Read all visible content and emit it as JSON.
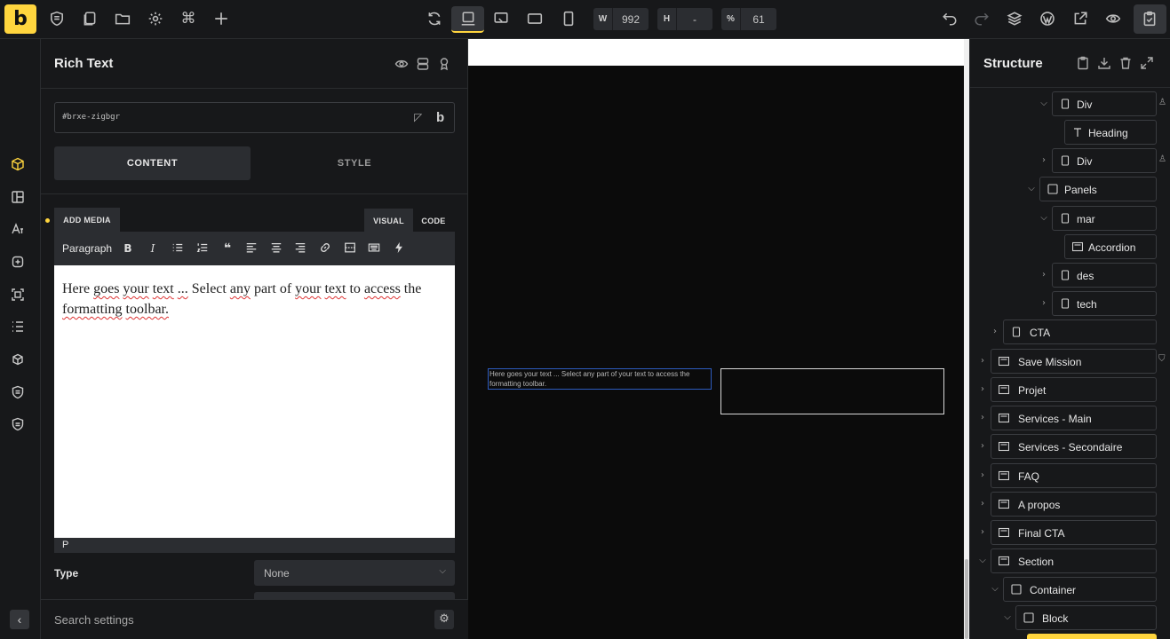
{
  "topbar": {
    "logo": "b",
    "width_label": "W",
    "width_value": "992",
    "height_label": "H",
    "height_value": "-",
    "scale_label": "%",
    "scale_value": "61"
  },
  "panel": {
    "title": "Rich Text",
    "element_id": "#brxe-zigbgr",
    "tabs": [
      "CONTENT",
      "STYLE"
    ],
    "add_media": "ADD MEDIA",
    "modes": [
      "VISUAL",
      "CODE"
    ],
    "paragraph_select": "Paragraph",
    "editor_words": [
      "Here",
      "goes",
      "your",
      "text",
      "...",
      "Select",
      "any",
      "part",
      "of",
      "your",
      "text",
      "to",
      "access",
      "the",
      "formatting",
      "toolbar."
    ],
    "status_path": "P",
    "type_label": "Type",
    "type_value": "None",
    "search_placeholder": "Search settings"
  },
  "canvas": {
    "preview_text": "Here goes your text ... Select any part of your text to access the formatting toolbar."
  },
  "structure": {
    "title": "Structure",
    "nodes": [
      {
        "label": "Div"
      },
      {
        "label": "Heading"
      },
      {
        "label": "Div"
      },
      {
        "label": "Panels"
      },
      {
        "label": "mar"
      },
      {
        "label": "Accordion"
      },
      {
        "label": "des"
      },
      {
        "label": "tech"
      },
      {
        "label": "CTA"
      },
      {
        "label": "Save Mission"
      },
      {
        "label": "Projet"
      },
      {
        "label": "Services - Main"
      },
      {
        "label": "Services - Secondaire"
      },
      {
        "label": "FAQ"
      },
      {
        "label": "A propos"
      },
      {
        "label": "Final CTA"
      },
      {
        "label": "Section"
      },
      {
        "label": "Container"
      },
      {
        "label": "Block"
      }
    ]
  },
  "colors": {
    "accent": "#ffd53e",
    "background": "#17181a",
    "selection": "#2d5bbd"
  }
}
